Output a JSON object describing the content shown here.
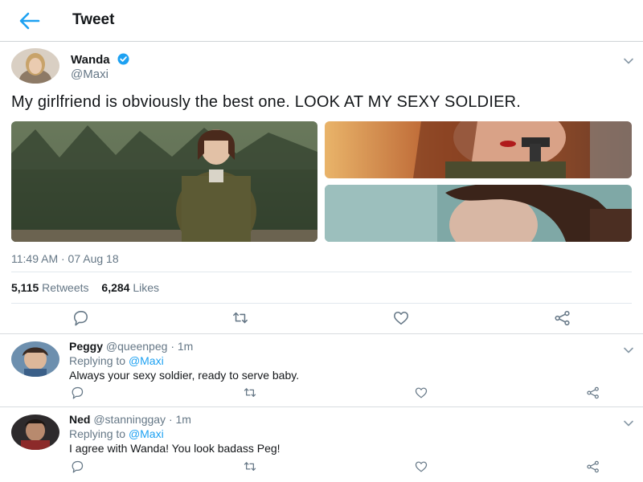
{
  "header": {
    "title": "Tweet",
    "back_icon": "arrow-left-icon",
    "accent": "#1da1f2"
  },
  "tweet": {
    "author_name": "Wanda",
    "author_handle": "@Maxi",
    "verified": true,
    "text": "My girlfriend is obviously the best one. LOOK AT MY SEXY SOLDIER.",
    "media_count": 3,
    "timestamp": "11:49 AM · 07 Aug 18",
    "retweets_count": "5,115",
    "retweets_label": "Retweets",
    "likes_count": "6,284",
    "likes_label": "Likes",
    "actions": [
      "reply-icon",
      "retweet-icon",
      "like-icon",
      "share-icon"
    ]
  },
  "replies": [
    {
      "name": "Peggy",
      "handle": "@queenpeg",
      "time": "· 1m",
      "replying_prefix": "Replying to",
      "replying_to": "@Maxi",
      "text": "Always your sexy soldier, ready to serve baby."
    },
    {
      "name": "Ned",
      "handle": "@stanninggay",
      "time": "· 1m",
      "replying_prefix": "Replying to",
      "replying_to": "@Maxi",
      "text": "I agree with Wanda! You look badass Peg!"
    }
  ],
  "colors": {
    "text": "#14171a",
    "secondary": "#657786",
    "link": "#1da1f2",
    "icon": "#657786"
  }
}
